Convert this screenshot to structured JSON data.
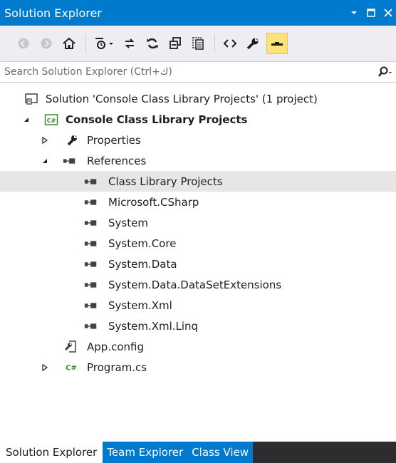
{
  "window": {
    "title": "Solution Explorer"
  },
  "toolbar": {
    "buttons": [
      "back-icon",
      "forward-icon",
      "home-icon",
      "pending-changes-filter-icon",
      "sync-icon",
      "refresh-icon",
      "collapse-all-icon",
      "show-all-files-icon",
      "view-code-icon",
      "properties-icon",
      "preview-selected-icon"
    ]
  },
  "search": {
    "placeholder": "Search Solution Explorer (Ctrl+ك)"
  },
  "tree": {
    "solution": "Solution 'Console Class Library Projects' (1 project)",
    "project": "Console Class Library Projects",
    "properties": "Properties",
    "references": "References",
    "refs": [
      "Class Library Projects",
      "Microsoft.CSharp",
      "System",
      "System.Core",
      "System.Data",
      "System.Data.DataSetExtensions",
      "System.Xml",
      "System.Xml.Linq"
    ],
    "app_config": "App.config",
    "program": "Program.cs"
  },
  "tabs": [
    "Solution Explorer",
    "Team Explorer",
    "Class View"
  ],
  "colors": {
    "accent": "#007acc",
    "selection": "#e6e6e6",
    "csharp_green": "#388a34",
    "active_button": "#fde27a"
  }
}
